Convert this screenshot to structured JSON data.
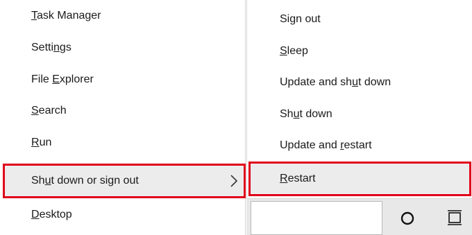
{
  "left_menu": {
    "items": [
      {
        "pre": "",
        "accel": "T",
        "post": "ask Manager"
      },
      {
        "pre": "Setti",
        "accel": "n",
        "post": "gs"
      },
      {
        "pre": "File ",
        "accel": "E",
        "post": "xplorer"
      },
      {
        "pre": "",
        "accel": "S",
        "post": "earch"
      },
      {
        "pre": "",
        "accel": "R",
        "post": "un"
      },
      {
        "pre": "Sh",
        "accel": "u",
        "post": "t down or sign out"
      },
      {
        "pre": "",
        "accel": "D",
        "post": "esktop"
      }
    ]
  },
  "sub_menu": {
    "items": [
      {
        "pre": "Si",
        "accel": "g",
        "post": "n out"
      },
      {
        "pre": "",
        "accel": "S",
        "post": "leep"
      },
      {
        "pre": "Update and sh",
        "accel": "u",
        "post": "t down"
      },
      {
        "pre": "Sh",
        "accel": "u",
        "post": "t down"
      },
      {
        "pre": "Update and ",
        "accel": "r",
        "post": "estart"
      },
      {
        "pre": "",
        "accel": "R",
        "post": "estart"
      }
    ]
  },
  "icons": {
    "submenu_arrow": "chevron-right-icon",
    "cortana": "cortana-circle-icon",
    "task_view": "task-view-icon"
  },
  "colors": {
    "highlight_border": "#e0001b",
    "highlight_fill": "#ececec"
  }
}
